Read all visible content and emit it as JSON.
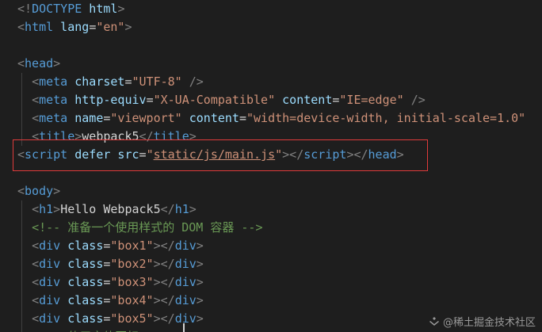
{
  "lines": [
    {
      "tokens": [
        {
          "t": "<!",
          "c": "punct"
        },
        {
          "t": "DOCTYPE",
          "c": "tag"
        },
        {
          "t": " html",
          "c": "attr"
        },
        {
          "t": ">",
          "c": "punct"
        }
      ]
    },
    {
      "tokens": [
        {
          "t": "<",
          "c": "punct"
        },
        {
          "t": "html",
          "c": "tag"
        },
        {
          "t": " lang",
          "c": "attr"
        },
        {
          "t": "=",
          "c": "text"
        },
        {
          "t": "\"en\"",
          "c": "str"
        },
        {
          "t": ">",
          "c": "punct"
        }
      ]
    },
    {
      "tokens": []
    },
    {
      "tokens": [
        {
          "t": "<",
          "c": "punct"
        },
        {
          "t": "head",
          "c": "tag"
        },
        {
          "t": ">",
          "c": "punct"
        }
      ]
    },
    {
      "tokens": [
        {
          "t": "  ",
          "c": "text"
        },
        {
          "t": "<",
          "c": "punct"
        },
        {
          "t": "meta",
          "c": "tag"
        },
        {
          "t": " charset",
          "c": "attr"
        },
        {
          "t": "=",
          "c": "text"
        },
        {
          "t": "\"UTF-8\"",
          "c": "str"
        },
        {
          "t": " />",
          "c": "punct"
        }
      ]
    },
    {
      "tokens": [
        {
          "t": "  ",
          "c": "text"
        },
        {
          "t": "<",
          "c": "punct"
        },
        {
          "t": "meta",
          "c": "tag"
        },
        {
          "t": " http-equiv",
          "c": "attr"
        },
        {
          "t": "=",
          "c": "text"
        },
        {
          "t": "\"X-UA-Compatible\"",
          "c": "str"
        },
        {
          "t": " content",
          "c": "attr"
        },
        {
          "t": "=",
          "c": "text"
        },
        {
          "t": "\"IE=edge\"",
          "c": "str"
        },
        {
          "t": " />",
          "c": "punct"
        }
      ]
    },
    {
      "tokens": [
        {
          "t": "  ",
          "c": "text"
        },
        {
          "t": "<",
          "c": "punct"
        },
        {
          "t": "meta",
          "c": "tag"
        },
        {
          "t": " name",
          "c": "attr"
        },
        {
          "t": "=",
          "c": "text"
        },
        {
          "t": "\"viewport\"",
          "c": "str"
        },
        {
          "t": " content",
          "c": "attr"
        },
        {
          "t": "=",
          "c": "text"
        },
        {
          "t": "\"width=device-width, initial-scale=1.0\"",
          "c": "str"
        }
      ]
    },
    {
      "tokens": [
        {
          "t": "  ",
          "c": "text"
        },
        {
          "t": "<",
          "c": "punct"
        },
        {
          "t": "title",
          "c": "tag"
        },
        {
          "t": ">",
          "c": "punct"
        },
        {
          "t": "webpack5",
          "c": "text"
        },
        {
          "t": "</",
          "c": "punct"
        },
        {
          "t": "title",
          "c": "tag"
        },
        {
          "t": ">",
          "c": "punct"
        }
      ]
    },
    {
      "tokens": [
        {
          "t": "<",
          "c": "punct"
        },
        {
          "t": "script",
          "c": "tag"
        },
        {
          "t": " defer",
          "c": "attr"
        },
        {
          "t": " src",
          "c": "attr"
        },
        {
          "t": "=",
          "c": "text"
        },
        {
          "t": "\"",
          "c": "str"
        },
        {
          "t": "static/js/main.js",
          "c": "str link"
        },
        {
          "t": "\"",
          "c": "str"
        },
        {
          "t": "></",
          "c": "punct"
        },
        {
          "t": "script",
          "c": "tag"
        },
        {
          "t": "></",
          "c": "punct"
        },
        {
          "t": "head",
          "c": "tag"
        },
        {
          "t": ">",
          "c": "punct"
        }
      ]
    },
    {
      "tokens": []
    },
    {
      "tokens": [
        {
          "t": "<",
          "c": "punct"
        },
        {
          "t": "body",
          "c": "tag"
        },
        {
          "t": ">",
          "c": "punct"
        }
      ]
    },
    {
      "tokens": [
        {
          "t": "  ",
          "c": "text"
        },
        {
          "t": "<",
          "c": "punct"
        },
        {
          "t": "h1",
          "c": "tag"
        },
        {
          "t": ">",
          "c": "punct"
        },
        {
          "t": "Hello Webpack5",
          "c": "text"
        },
        {
          "t": "</",
          "c": "punct"
        },
        {
          "t": "h1",
          "c": "tag"
        },
        {
          "t": ">",
          "c": "punct"
        }
      ]
    },
    {
      "tokens": [
        {
          "t": "  ",
          "c": "text"
        },
        {
          "t": "<!-- 准备一个使用样式的 DOM 容器 -->",
          "c": "comment"
        }
      ]
    },
    {
      "tokens": [
        {
          "t": "  ",
          "c": "text"
        },
        {
          "t": "<",
          "c": "punct"
        },
        {
          "t": "div",
          "c": "tag"
        },
        {
          "t": " class",
          "c": "attr"
        },
        {
          "t": "=",
          "c": "text"
        },
        {
          "t": "\"box1\"",
          "c": "str"
        },
        {
          "t": "></",
          "c": "punct"
        },
        {
          "t": "div",
          "c": "tag"
        },
        {
          "t": ">",
          "c": "punct"
        }
      ]
    },
    {
      "tokens": [
        {
          "t": "  ",
          "c": "text"
        },
        {
          "t": "<",
          "c": "punct"
        },
        {
          "t": "div",
          "c": "tag"
        },
        {
          "t": " class",
          "c": "attr"
        },
        {
          "t": "=",
          "c": "text"
        },
        {
          "t": "\"box2\"",
          "c": "str"
        },
        {
          "t": "></",
          "c": "punct"
        },
        {
          "t": "div",
          "c": "tag"
        },
        {
          "t": ">",
          "c": "punct"
        }
      ]
    },
    {
      "tokens": [
        {
          "t": "  ",
          "c": "text"
        },
        {
          "t": "<",
          "c": "punct"
        },
        {
          "t": "div",
          "c": "tag"
        },
        {
          "t": " class",
          "c": "attr"
        },
        {
          "t": "=",
          "c": "text"
        },
        {
          "t": "\"box3\"",
          "c": "str"
        },
        {
          "t": "></",
          "c": "punct"
        },
        {
          "t": "div",
          "c": "tag"
        },
        {
          "t": ">",
          "c": "punct"
        }
      ]
    },
    {
      "tokens": [
        {
          "t": "  ",
          "c": "text"
        },
        {
          "t": "<",
          "c": "punct"
        },
        {
          "t": "div",
          "c": "tag"
        },
        {
          "t": " class",
          "c": "attr"
        },
        {
          "t": "=",
          "c": "text"
        },
        {
          "t": "\"box4\"",
          "c": "str"
        },
        {
          "t": "></",
          "c": "punct"
        },
        {
          "t": "div",
          "c": "tag"
        },
        {
          "t": ">",
          "c": "punct"
        }
      ]
    },
    {
      "tokens": [
        {
          "t": "  ",
          "c": "text"
        },
        {
          "t": "<",
          "c": "punct"
        },
        {
          "t": "div",
          "c": "tag"
        },
        {
          "t": " class",
          "c": "attr"
        },
        {
          "t": "=",
          "c": "text"
        },
        {
          "t": "\"box5\"",
          "c": "str"
        },
        {
          "t": "></",
          "c": "punct"
        },
        {
          "t": "div",
          "c": "tag"
        },
        {
          "t": ">",
          "c": "punct"
        }
      ]
    },
    {
      "tokens": [
        {
          "t": "  ",
          "c": "text"
        },
        {
          "t": "<!-- 使用字体图标 -->",
          "c": "comment"
        }
      ]
    }
  ],
  "highlight_color": "#e03b3b",
  "watermark": {
    "text": "@稀土掘金技术社区"
  }
}
